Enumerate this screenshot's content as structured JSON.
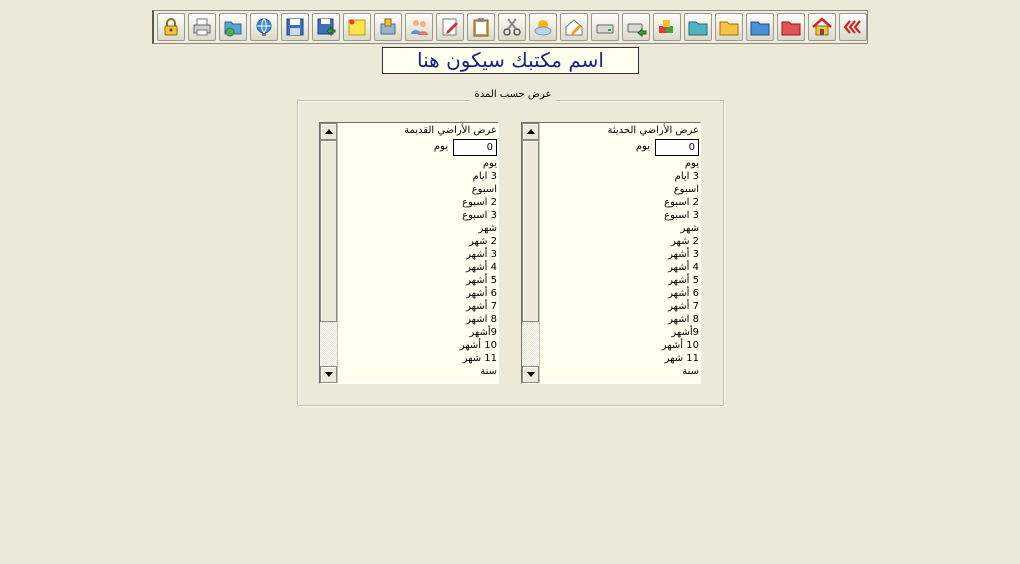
{
  "toolbar": {
    "buttons": [
      {
        "name": "lock-icon",
        "title": "Lock"
      },
      {
        "name": "printer-icon",
        "title": "Print"
      },
      {
        "name": "open-folder-icon",
        "title": "Open"
      },
      {
        "name": "globe-icon",
        "title": "Internet"
      },
      {
        "name": "save-disk-icon",
        "title": "Save"
      },
      {
        "name": "save-back-icon",
        "title": "Save back"
      },
      {
        "name": "sticky-note-icon",
        "title": "Notes"
      },
      {
        "name": "tools-icon",
        "title": "Tools"
      },
      {
        "name": "users-icon",
        "title": "Users"
      },
      {
        "name": "edit-form-icon",
        "title": "Edit"
      },
      {
        "name": "clipboard-icon",
        "title": "Clipboard"
      },
      {
        "name": "scissors-icon",
        "title": "Cut"
      },
      {
        "name": "weather-icon",
        "title": "Weather"
      },
      {
        "name": "house-edit-icon",
        "title": "Edit property"
      },
      {
        "name": "drive-icon",
        "title": "Drive"
      },
      {
        "name": "drive-add-icon",
        "title": "Drive add"
      },
      {
        "name": "boxes-icon",
        "title": "Boxes"
      },
      {
        "name": "folder-teal-icon",
        "title": "Folder"
      },
      {
        "name": "folder-yellow-icon",
        "title": "Folder"
      },
      {
        "name": "folder-blue-icon",
        "title": "Folder"
      },
      {
        "name": "folder-red-icon",
        "title": "Folder"
      },
      {
        "name": "home-icon",
        "title": "Home"
      },
      {
        "name": "back-arrows-icon",
        "title": "Back"
      }
    ]
  },
  "office_title": "اسم مكتبك سيكون هنا",
  "period_group": {
    "legend": "عرض حسب المدة",
    "new_lands": {
      "title": "عرض الأراضي الحديثة",
      "value": "0",
      "unit": "يوم",
      "options": [
        "يوم",
        "3 ايام",
        "اسبوع",
        "2 اسبوع",
        "3 اسبوع",
        "شهر",
        "2 شهر",
        "3 أشهر",
        "4 أشهر",
        "5 أشهر",
        "6 أشهر",
        "7 أشهر",
        "8 اشهر",
        "9أشهر",
        "10 أشهر",
        "11 شهر",
        "سنة"
      ]
    },
    "old_lands": {
      "title": "عرض الأراضي القديمة",
      "value": "0",
      "unit": "يوم",
      "options": [
        "يوم",
        "3 ايام",
        "اسبوع",
        "2 اسبوع",
        "3 اسبوع",
        "شهر",
        "2 شهر",
        "3 أشهر",
        "4 أشهر",
        "5 أشهر",
        "6 أشهر",
        "7 أشهر",
        "8 اشهر",
        "9أشهر",
        "10 أشهر",
        "11 شهر",
        "سنة"
      ]
    }
  }
}
